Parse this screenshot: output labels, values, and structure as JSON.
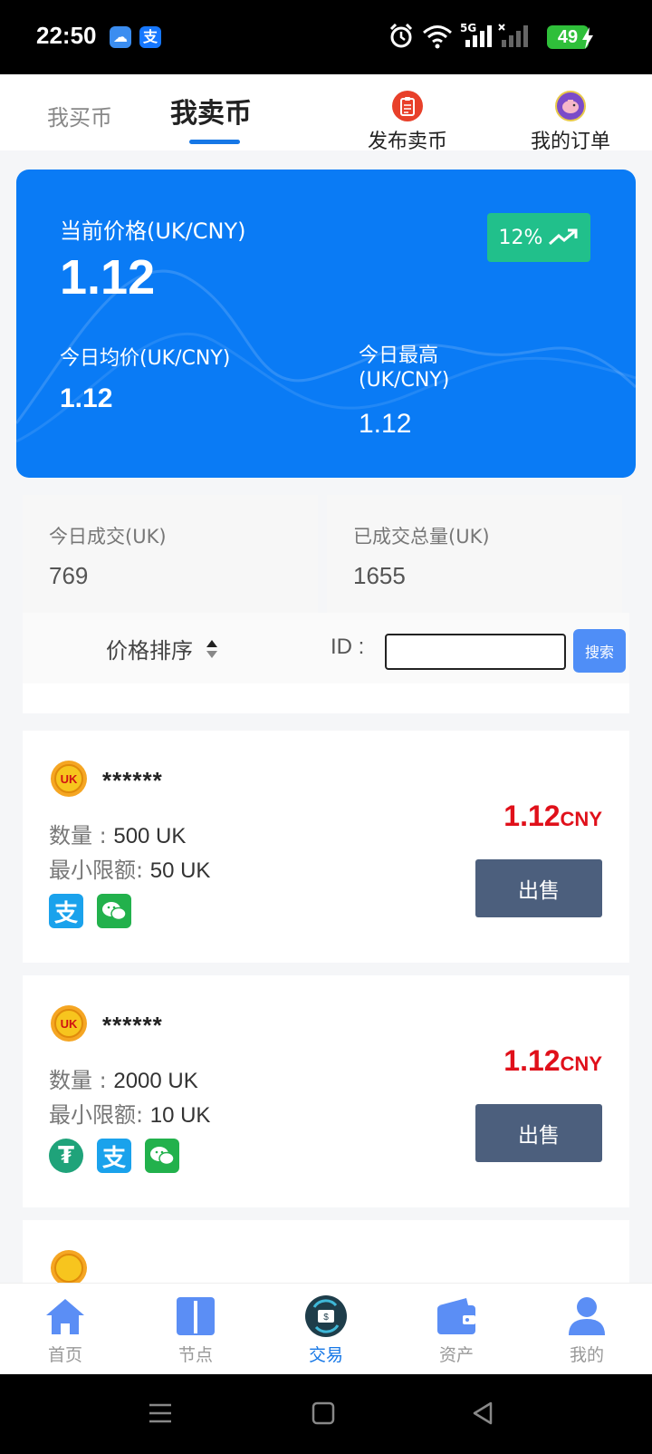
{
  "status_bar": {
    "time": "22:50",
    "network": "5G",
    "battery": "49"
  },
  "top_nav": {
    "tab_buy": "我买币",
    "tab_sell": "我卖币",
    "publish_label": "发布卖币",
    "orders_label": "我的订单"
  },
  "price_card": {
    "current_label": "当前价格(UK/CNY)",
    "current_price": "1.12",
    "change_badge": "12%",
    "avg_label": "今日均价(UK/CNY)",
    "avg_value": "1.12",
    "high_label": "今日最高(UK/CNY)",
    "high_value": "1.12"
  },
  "stats": {
    "today_label": "今日成交(UK)",
    "today_value": "769",
    "total_label": "已成交总量(UK)",
    "total_value": "1655"
  },
  "filter": {
    "sort_label": "价格排序",
    "id_label": "ID :",
    "id_value": "",
    "search_label": "搜索"
  },
  "listings": [
    {
      "avatar_text": "UK",
      "user": "******",
      "qty_label": "数量 : ",
      "qty_value": "500 UK",
      "min_label": "最小限额: ",
      "min_value": "50 UK",
      "price": "1.12",
      "unit": "CNY",
      "sell_label": "出售",
      "payments": [
        "alipay-icon",
        "wechat-pay-icon"
      ]
    },
    {
      "avatar_text": "UK",
      "user": "******",
      "qty_label": "数量 : ",
      "qty_value": "2000 UK",
      "min_label": "最小限额: ",
      "min_value": "10 UK",
      "price": "1.12",
      "unit": "CNY",
      "sell_label": "出售",
      "payments": [
        "usdt-icon",
        "alipay-icon",
        "wechat-pay-icon"
      ]
    }
  ],
  "tab_bar": [
    {
      "label": "首页",
      "icon": "home-icon"
    },
    {
      "label": "节点",
      "icon": "node-icon"
    },
    {
      "label": "交易",
      "icon": "exchange-icon",
      "active": true
    },
    {
      "label": "资产",
      "icon": "wallet-icon"
    },
    {
      "label": "我的",
      "icon": "user-icon"
    }
  ],
  "colors": {
    "accent": "#1677e6",
    "card_blue": "#0a7bf5",
    "badge_green": "#21c08b",
    "price_red": "#e0101a",
    "sell_button": "#4c5f7d"
  }
}
